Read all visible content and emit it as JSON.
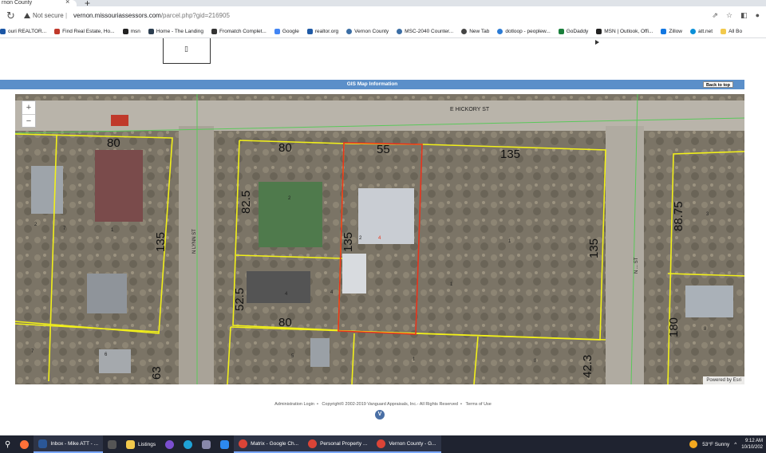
{
  "browser": {
    "tab_title": "rnon County",
    "url_security": "Not secure",
    "url_host": "vernon.missouriassessors.com",
    "url_path": "/parcel.php?gid=216905"
  },
  "bookmarks": [
    "ouri REALTOR...",
    "Find Real Estate, Ho...",
    "msn",
    "Home - The Landing",
    "Fromatch Complet...",
    "Google",
    "realtor.org",
    "Vernon County",
    "MSC-2040 Counter...",
    "New Tab",
    "dotloop - peoplew...",
    "GoDaddy",
    "MSN | Outlook, Offi...",
    "Zillow",
    "att.net",
    "All Bo"
  ],
  "page": {
    "gis_header": "GIS Map Information",
    "back_to_top": "Back to top",
    "map": {
      "street_labels": {
        "top": "E HICKORY ST",
        "left": "N LYNN ST",
        "right": "N ... ST"
      },
      "dimensions": [
        "80",
        "80",
        "55",
        "135",
        "82.5",
        "135",
        "135",
        "135",
        "52.5",
        "80",
        "88.75",
        "180",
        "42.3",
        "63"
      ],
      "lot_numbers": [
        "2",
        "1",
        "2",
        "2",
        "4",
        "1",
        "3",
        "4",
        "7",
        "5",
        "8",
        "1",
        "8",
        "6",
        "7",
        "1",
        "4"
      ],
      "zoom_in": "+",
      "zoom_out": "−",
      "powered_by": "Powered by Esri"
    },
    "footer": {
      "admin_login": "Administration Login",
      "copyright": "Copyright© 2002-2019 Vanguard Appraisals, Inc.- All Rights Reserved",
      "terms": "Terms of Use",
      "logo_letter": "V"
    }
  },
  "taskbar": {
    "items": [
      "Inbox - Mike ATT - ...",
      "Listings",
      "Matrix - Google Ch...",
      "Personal Property ...",
      "Vernon County - G..."
    ],
    "weather": "53°F Sunny",
    "time": "9:12 AM",
    "date": "10/10/202"
  }
}
